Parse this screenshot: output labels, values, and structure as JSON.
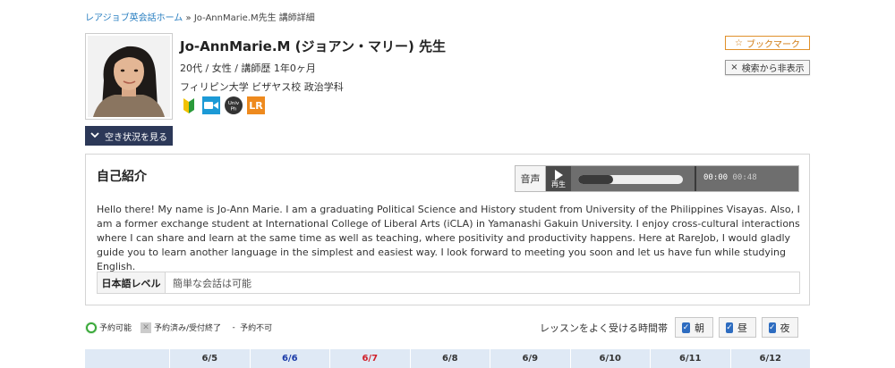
{
  "breadcrumb": {
    "home": "レアジョブ英会話ホーム",
    "separator": "»",
    "current": "Jo-AnnMarie.M先生 講師詳細"
  },
  "tutor": {
    "name": "Jo-AnnMarie.M (ジョアン・マリー) 先生",
    "meta": "20代 / 女性 / 講師歴  1年0ヶ月",
    "school": "フィリピン大学   ビザヤス校  政治学科",
    "badges": [
      {
        "icon": "beginner-mark-icon"
      },
      {
        "icon": "video-camera-icon"
      },
      {
        "icon": "university-ph-icon",
        "text": "Univ Ph"
      },
      {
        "icon": "lr-icon",
        "text": "LR"
      }
    ]
  },
  "actions": {
    "bookmark": {
      "icon": "star-icon",
      "label": "ブックマーク"
    },
    "hide": {
      "icon": "close-icon",
      "label": "検索から非表示"
    },
    "availability": {
      "icon": "chevron-down-icon",
      "label": "空き状況を見る"
    }
  },
  "intro": {
    "title": "自己紹介",
    "audio": {
      "label": "音声",
      "play_label": "再生",
      "time_current": "00:00",
      "time_total": "00:48",
      "progress": 0.33
    },
    "text": "Hello there! My name is Jo-Ann Marie. I am a graduating Political Science and History student from University of the Philippines Visayas. Also, I am a former exchange student at International College of Liberal Arts (iCLA) in Yamanashi Gakuin University. I enjoy cross-cultural interactions where I can share and learn at the same time as well as teaching, where positivity and productivity happens. Here at RareJob, I would gladly guide you to learn another language in the simplest and easiest way. I look forward to meeting you soon and let us have fun while studying English.",
    "japanese_level_label": "日本語レベル",
    "japanese_level_value": "簡単な会話は可能"
  },
  "legend": {
    "available": "予約可能",
    "booked": "予約済み/受付終了",
    "none_symbol": "-",
    "unavailable": "予約不可"
  },
  "time_pref": {
    "label": "レッスンをよく受ける時間帯",
    "options": [
      {
        "label": "朝",
        "checked": true
      },
      {
        "label": "昼",
        "checked": true
      },
      {
        "label": "夜",
        "checked": true
      }
    ]
  },
  "schedule": {
    "days": [
      {
        "date": "6/5",
        "color": "#333333"
      },
      {
        "date": "6/6",
        "color": "#1a3aa8"
      },
      {
        "date": "6/7",
        "color": "#d0202a"
      },
      {
        "date": "6/8",
        "color": "#333333"
      },
      {
        "date": "6/9",
        "color": "#333333"
      },
      {
        "date": "6/10",
        "color": "#333333"
      },
      {
        "date": "6/11",
        "color": "#333333"
      },
      {
        "date": "6/12",
        "color": "#333333"
      }
    ]
  },
  "colors": {
    "link": "#2a7fc1",
    "bookmark_accent": "#e0902a",
    "nav_button": "#2c3858",
    "header_bg": "#dfe9f5",
    "available_green": "#39a939",
    "checkbox_blue": "#2d6cc0"
  }
}
